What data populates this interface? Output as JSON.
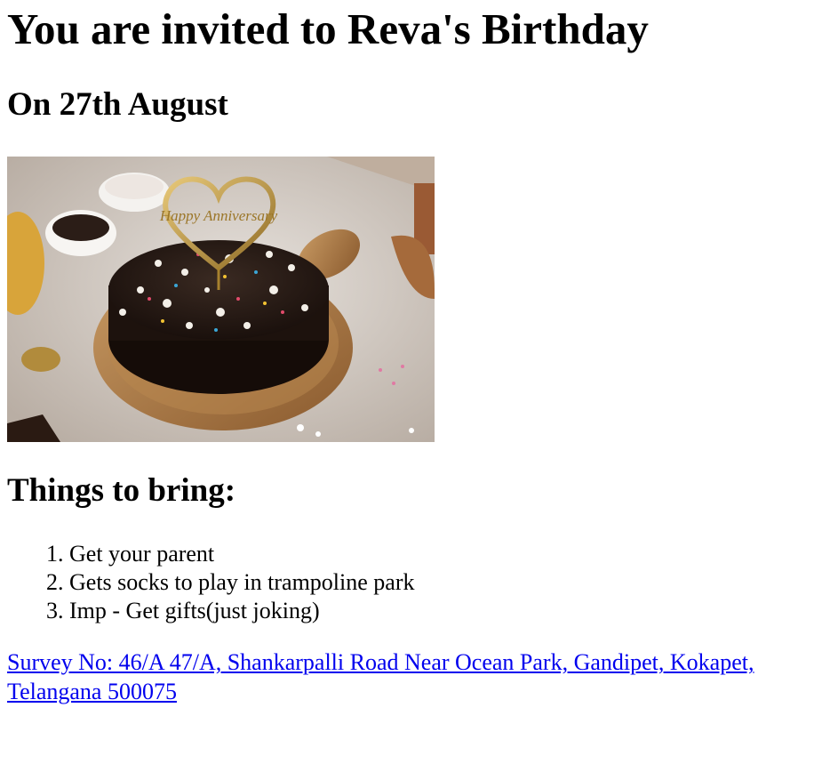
{
  "heading": "You are invited to Reva's Birthday",
  "date_heading": "On 27th August",
  "image": {
    "topper_text": "Happy Anniversary"
  },
  "things_heading": "Things to bring:",
  "things": [
    "Get your parent",
    "Gets socks to play in trampoline park",
    "Imp - Get gifts(just joking)"
  ],
  "address_link": "Survey No: 46/A 47/A, Shankarpalli Road Near Ocean Park, Gandipet, Kokapet, Telangana 500075",
  "colors": {
    "link": "#0000ee",
    "text": "#000000"
  }
}
